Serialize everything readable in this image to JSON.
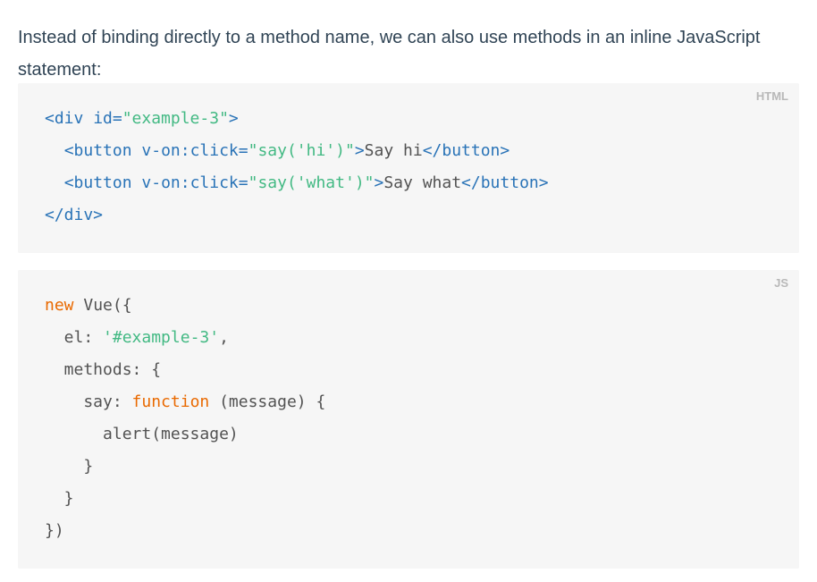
{
  "intro": {
    "text": "Instead of binding directly to a method name, we can also use methods in an inline JavaScript statement:"
  },
  "html_block": {
    "label": "HTML",
    "lines": [
      [
        {
          "t": "<div ",
          "c": "tag"
        },
        {
          "t": "id=",
          "c": "attr"
        },
        {
          "t": "\"example-3\"",
          "c": "str"
        },
        {
          "t": ">",
          "c": "tag"
        }
      ],
      [
        {
          "t": "  ",
          "c": "plain"
        },
        {
          "t": "<button ",
          "c": "tag"
        },
        {
          "t": "v-on:click=",
          "c": "attr"
        },
        {
          "t": "\"say('hi')\"",
          "c": "str"
        },
        {
          "t": ">",
          "c": "tag"
        },
        {
          "t": "Say hi",
          "c": "plain"
        },
        {
          "t": "</button>",
          "c": "tag"
        }
      ],
      [
        {
          "t": "  ",
          "c": "plain"
        },
        {
          "t": "<button ",
          "c": "tag"
        },
        {
          "t": "v-on:click=",
          "c": "attr"
        },
        {
          "t": "\"say('what')\"",
          "c": "str"
        },
        {
          "t": ">",
          "c": "tag"
        },
        {
          "t": "Say what",
          "c": "plain"
        },
        {
          "t": "</button>",
          "c": "tag"
        }
      ],
      [
        {
          "t": "</div>",
          "c": "tag"
        }
      ]
    ]
  },
  "js_block": {
    "label": "JS",
    "lines": [
      [
        {
          "t": "new",
          "c": "kw"
        },
        {
          "t": " Vue({",
          "c": "plain"
        }
      ],
      [
        {
          "t": "  el: ",
          "c": "plain"
        },
        {
          "t": "'#example-3'",
          "c": "str"
        },
        {
          "t": ",",
          "c": "plain"
        }
      ],
      [
        {
          "t": "  methods: {",
          "c": "plain"
        }
      ],
      [
        {
          "t": "    say: ",
          "c": "plain"
        },
        {
          "t": "function",
          "c": "kw"
        },
        {
          "t": " (message) {",
          "c": "plain"
        }
      ],
      [
        {
          "t": "      alert(message)",
          "c": "plain"
        }
      ],
      [
        {
          "t": "    }",
          "c": "plain"
        }
      ],
      [
        {
          "t": "  }",
          "c": "plain"
        }
      ],
      [
        {
          "t": "})",
          "c": "plain"
        }
      ]
    ]
  }
}
